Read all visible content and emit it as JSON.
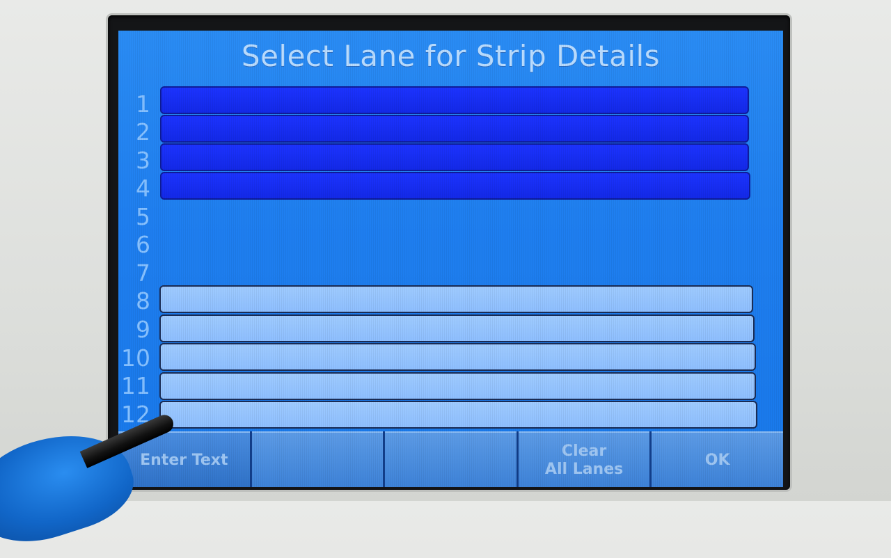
{
  "screen": {
    "title": "Select Lane for Strip Details"
  },
  "lanes": [
    {
      "number": "1",
      "state": "selected"
    },
    {
      "number": "2",
      "state": "selected"
    },
    {
      "number": "3",
      "state": "selected"
    },
    {
      "number": "4",
      "state": "selected"
    },
    {
      "number": "5",
      "state": "empty"
    },
    {
      "number": "6",
      "state": "empty"
    },
    {
      "number": "7",
      "state": "empty"
    },
    {
      "number": "8",
      "state": "available"
    },
    {
      "number": "9",
      "state": "available"
    },
    {
      "number": "10",
      "state": "available"
    },
    {
      "number": "11",
      "state": "available"
    },
    {
      "number": "12",
      "state": "available"
    }
  ],
  "softkeys": [
    {
      "label": "Enter Text"
    },
    {
      "label": ""
    },
    {
      "label": ""
    },
    {
      "label": "Clear\nAll Lanes"
    },
    {
      "label": "OK"
    }
  ],
  "colors": {
    "screen_background": "#1f7ff0",
    "selected_lane": "#1c33ff",
    "available_lane": "#9fcbff",
    "title_text": "#b9dcff"
  }
}
